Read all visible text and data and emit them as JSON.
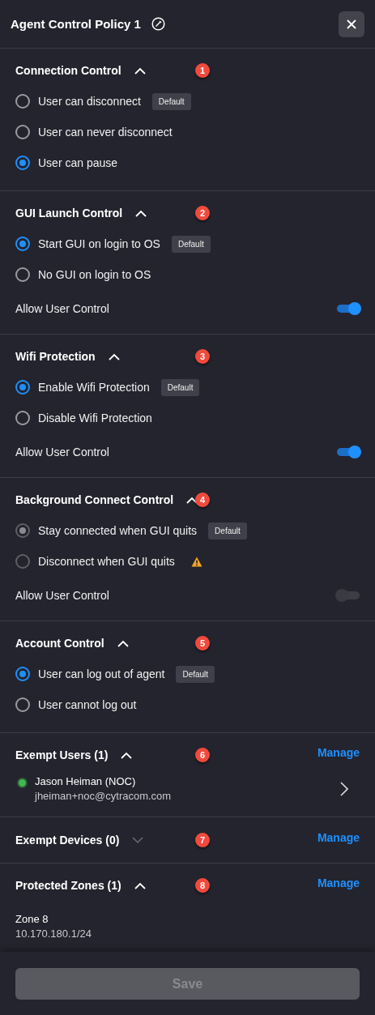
{
  "panel": {
    "title": "Agent Control Policy 1"
  },
  "sections": [
    {
      "kind": "options",
      "title": "Connection Control",
      "expanded": true,
      "badge": "1",
      "disabled": false,
      "options": [
        {
          "label": "User can disconnect",
          "selected": false,
          "tag": "Default"
        },
        {
          "label": "User can never disconnect",
          "selected": false
        },
        {
          "label": "User can pause",
          "selected": true
        }
      ]
    },
    {
      "kind": "options",
      "title": "GUI Launch Control",
      "expanded": true,
      "badge": "2",
      "disabled": false,
      "options": [
        {
          "label": "Start GUI on login to OS",
          "selected": true,
          "tag": "Default"
        },
        {
          "label": "No GUI on login to OS",
          "selected": false
        }
      ],
      "toggle": {
        "label": "Allow User Control",
        "on": true
      }
    },
    {
      "kind": "options",
      "title": "Wifi Protection",
      "expanded": true,
      "badge": "3",
      "disabled": false,
      "options": [
        {
          "label": "Enable Wifi Protection",
          "selected": true,
          "tag": "Default"
        },
        {
          "label": "Disable Wifi Protection",
          "selected": false
        }
      ],
      "toggle": {
        "label": "Allow User Control",
        "on": true
      }
    },
    {
      "kind": "options",
      "title": "Background Connect Control",
      "expanded": true,
      "badge": "4",
      "disabled": true,
      "options": [
        {
          "label": "Stay connected when GUI quits",
          "selected": true,
          "tag": "Default"
        },
        {
          "label": "Disconnect when GUI quits",
          "selected": false,
          "warning": true
        }
      ],
      "toggle": {
        "label": "Allow User Control",
        "on": false
      }
    },
    {
      "kind": "options",
      "title": "Account Control",
      "expanded": true,
      "badge": "5",
      "disabled": false,
      "options": [
        {
          "label": "User can log out of agent",
          "selected": true,
          "tag": "Default"
        },
        {
          "label": "User cannot log out",
          "selected": false
        }
      ]
    },
    {
      "kind": "users",
      "title": "Exempt Users (1)",
      "expanded": true,
      "badge": "6",
      "link": "Manage",
      "users": [
        {
          "name": "Jason Heiman (NOC)",
          "email": "jheiman+noc@cytracom.com",
          "color": "#3fb950"
        }
      ]
    },
    {
      "kind": "devices",
      "title": "Exempt Devices (0)",
      "expanded": false,
      "badge": "7",
      "link": "Manage"
    },
    {
      "kind": "zones",
      "title": "Protected Zones (1)",
      "expanded": true,
      "badge": "8",
      "link": "Manage",
      "zones": [
        {
          "name": "Zone 8",
          "subnet": "10.170.180.1/24"
        }
      ]
    }
  ],
  "save_button": {
    "label": "Save",
    "disabled": true
  }
}
